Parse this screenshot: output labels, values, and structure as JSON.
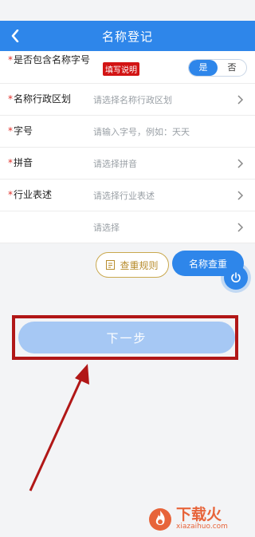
{
  "header": {
    "title": "名称登记",
    "back_icon": "chevron-left-icon"
  },
  "form": {
    "rows": [
      {
        "label": "是否包含名称字号",
        "required": true,
        "tag": "填写说明",
        "toggle": {
          "yes": "是",
          "no": "否",
          "selected": "是"
        }
      },
      {
        "label": "名称行政区划",
        "required": true,
        "placeholder": "请选择名称行政区划",
        "has_chevron": true
      },
      {
        "label": "字号",
        "required": true,
        "placeholder": "请输入字号，例如：天天",
        "has_chevron": false
      },
      {
        "label": "拼音",
        "required": true,
        "placeholder": "请选择拼音",
        "has_chevron": true
      },
      {
        "label": "行业表述",
        "required": true,
        "placeholder": "请选择行业表述",
        "has_chevron": true
      },
      {
        "label": "",
        "required": false,
        "placeholder": "请选择",
        "has_chevron": true
      }
    ]
  },
  "buttons": {
    "rule": "查重规则",
    "check": "名称查重",
    "next": "下一步"
  },
  "watermark": {
    "title": "下载火",
    "url": "xiazaihuo.com"
  },
  "colors": {
    "primary": "#2e86ea",
    "next_disabled": "#a6c8f4",
    "highlight_red": "#b11717",
    "required_star": "#e0302a"
  }
}
